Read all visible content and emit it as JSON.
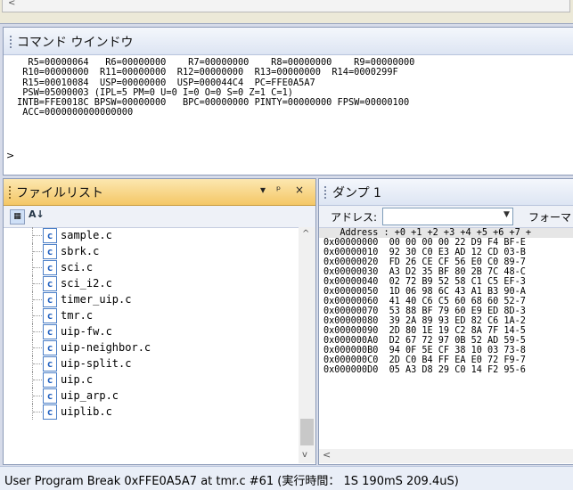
{
  "command_window": {
    "title": "コマンド ウインドウ",
    "lines": [
      "  R5=00000064   R6=00000000    R7=00000000    R8=00000000    R9=00000000",
      " R10=00000000  R11=00000000  R12=00000000  R13=00000000  R14=0000299F",
      " R15=00010084  USP=00000000  USP=000044C4  PC=FFE0A5A7",
      " PSW=05000003 (IPL=5 PM=0 U=0 I=0 O=0 S=0 Z=1 C=1)",
      "INTB=FFE0018C BPSW=00000000   BPC=00000000 PINTY=00000000 FPSW=00000100",
      " ACC=0000000000000000"
    ],
    "prompt": ">"
  },
  "file_list": {
    "title": "ファイルリスト",
    "pin_label": "▾ ⁴ ×",
    "files": [
      "sample.c",
      "sbrk.c",
      "sci.c",
      "sci_i2.c",
      "timer_uip.c",
      "tmr.c",
      "uip-fw.c",
      "uip-neighbor.c",
      "uip-split.c",
      "uip.c",
      "uip_arp.c",
      "uiplib.c"
    ],
    "file_icon": "c-source-file-icon"
  },
  "dump": {
    "title": "ダンプ 1",
    "address_label": "アドレス:",
    "format_label": "フォーマッ",
    "header": "   Address : +0 +1 +2 +3 +4 +5 +6 +7 +",
    "rows": [
      "0x00000000  00 00 00 00 22 D9 F4 BF-E",
      "0x00000010  92 30 C0 E3 AD 12 CD 03-B",
      "0x00000020  FD 26 CE CF 56 E0 C0 89-7",
      "0x00000030  A3 D2 35 BF 80 2B 7C 48-C",
      "0x00000040  02 72 B9 52 58 C1 C5 EF-3",
      "0x00000050  1D 06 98 6C 43 A1 B3 90-A",
      "0x00000060  41 40 C6 C5 60 68 60 52-7",
      "0x00000070  53 88 BF 79 60 E9 ED 8D-3",
      "0x00000080  39 2A 89 93 ED 82 C6 1A-2",
      "0x00000090  2D 80 1E 19 C2 8A 7F 14-5",
      "0x000000A0  D2 67 72 97 0B 52 AD 59-5",
      "0x000000B0  94 0F 5E CF 38 10 03 73-8",
      "0x000000C0  2D C0 B4 FF EA E0 72 F9-7",
      "0x000000D0  05 A3 D8 29 C0 14 F2 95-6"
    ]
  },
  "status_bar": {
    "text": "User Program Break 0xFFE0A5A7 at tmr.c #61 (実行時間：  1S 190mS 209.4uS)"
  }
}
